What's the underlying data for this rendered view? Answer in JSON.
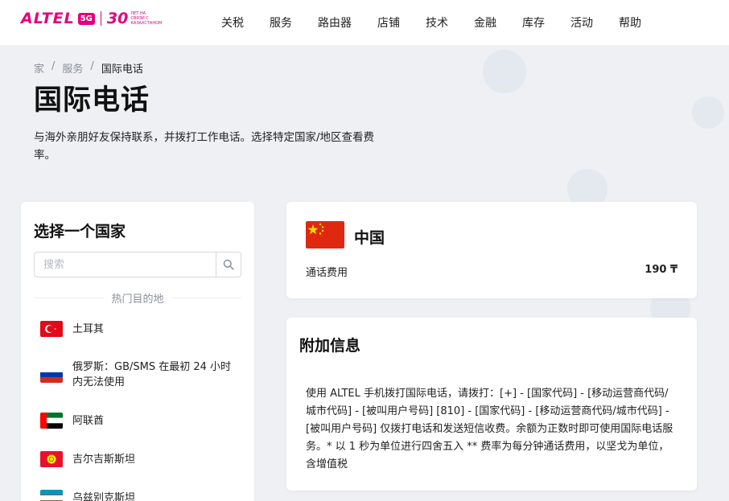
{
  "header": {
    "logo": {
      "brand": "ALTEL",
      "badge": "5G",
      "anniversary": "30",
      "tagline": "ЛЕТ НА СВЯЗИ С КАЗАХСТАНОМ"
    },
    "nav": [
      "关税",
      "服务",
      "路由器",
      "店铺",
      "技术",
      "金融",
      "库存",
      "活动",
      "帮助"
    ]
  },
  "breadcrumb": {
    "home": "家",
    "section": "服务",
    "current": "国际电话",
    "separator": "/"
  },
  "page": {
    "title": "国际电话",
    "intro": "与海外亲朋好友保持联系，并拨打工作电话。选择特定国家/地区查看费率。"
  },
  "country_picker": {
    "title": "选择一个国家",
    "search_placeholder": "搜索",
    "popular_label": "热门目的地",
    "countries": [
      {
        "name": "土耳其",
        "flag": "turkey"
      },
      {
        "name": "俄罗斯：GB/SMS 在最初 24 小时内无法使用",
        "flag": "russia"
      },
      {
        "name": "阿联酋",
        "flag": "uae"
      },
      {
        "name": "吉尔吉斯斯坦",
        "flag": "kyrgyzstan"
      },
      {
        "name": "乌兹别克斯坦",
        "flag": "uzbekistan"
      }
    ]
  },
  "selected_country": {
    "name": "中国",
    "flag": "china",
    "fee_label": "通话费用",
    "fee_value": "190 ₸"
  },
  "additional_info": {
    "title": "附加信息",
    "text": "使用 ALTEL 手机拨打国际电话，请拨打：[+] - [国家代码] - [移动运营商代码/城市代码] - [被叫用户号码] [810] - [国家代码] - [移动运营商代码/城市代码] - [被叫用户号码] 仅拨打电话和发送短信收费。余额为正数时即可使用国际电话服务。* 以 1 秒为单位进行四舍五入 ** 费率为每分钟通话费用，以坚戈为单位，含增值税"
  },
  "colors": {
    "brand": "#e4007c",
    "background": "#eef0f3",
    "card": "#ffffff"
  }
}
